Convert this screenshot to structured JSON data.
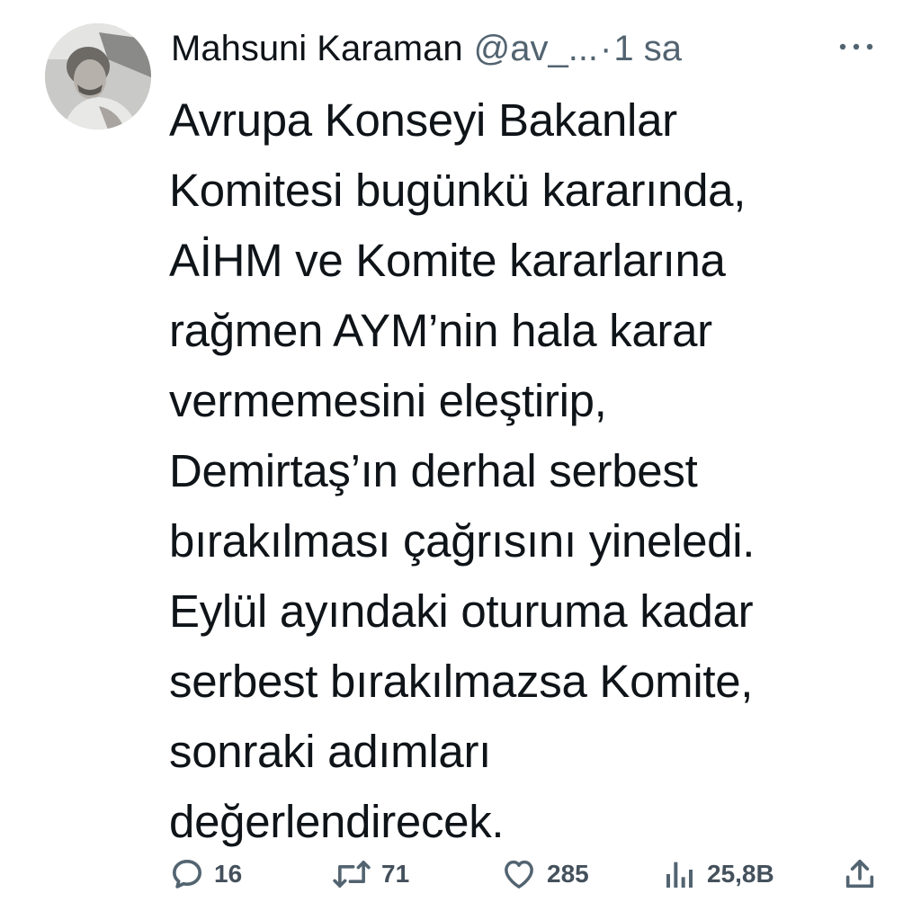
{
  "author": {
    "display_name": "Mahsuni Karaman",
    "handle": "@av_...",
    "separator": "·",
    "time": "1 sa"
  },
  "tweet": {
    "lines": [
      "Avrupa Konseyi Bakanlar",
      "Komitesi bugünkü kararında,",
      "AİHM ve Komite kararlarına",
      "rağmen AYM’nin hala karar",
      "vermemesini eleştirip,",
      "Demirtaş’ın derhal serbest",
      "bırakılması çağrısını yineledi.",
      "Eylül ayındaki oturuma kadar",
      "serbest bırakılmazsa Komite,",
      "sonraki adımları",
      "değerlendirecek."
    ]
  },
  "actions": {
    "replies": "16",
    "retweets": "71",
    "likes": "285",
    "views": "25,8B"
  },
  "icons": {
    "more": "more-horizontal-icon",
    "reply": "reply-icon",
    "retweet": "retweet-icon",
    "like": "heart-icon",
    "views": "views-icon",
    "share": "share-icon"
  },
  "colors": {
    "text": "#0f1419",
    "secondary": "#536471",
    "background": "#ffffff"
  }
}
